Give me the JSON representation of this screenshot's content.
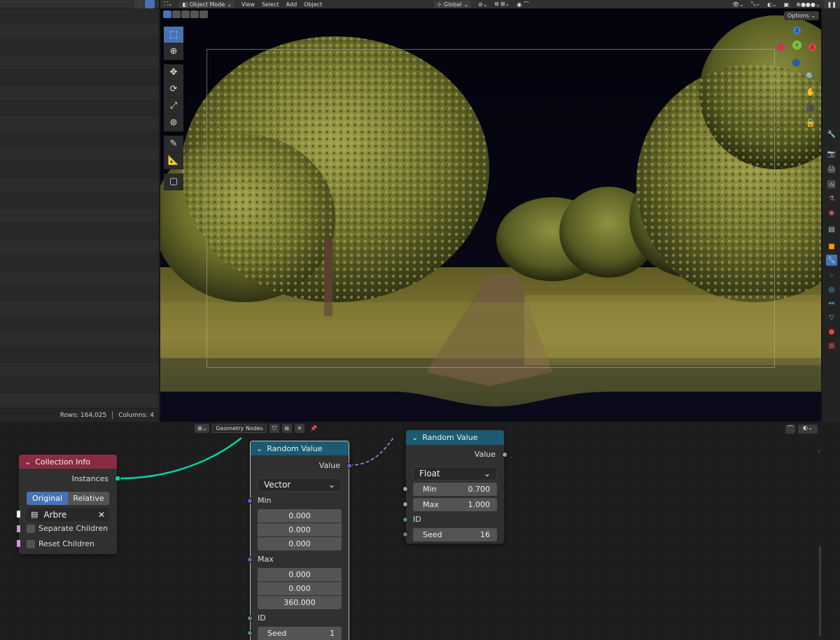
{
  "spreadsheet": {
    "rows_label": "Rows: 164,025",
    "columns_label": "Columns: 4"
  },
  "viewport_header": {
    "mode": "Object Mode",
    "menus": [
      "View",
      "Select",
      "Add",
      "Object"
    ],
    "transform_orientation": "Global",
    "options_label": "Options"
  },
  "gizmo": {
    "z": "Z",
    "y": "Y",
    "x": "X"
  },
  "node_editor_header": {
    "tree_name": "Geometry Nodes"
  },
  "nodes": {
    "collection_info": {
      "title": "Collection Info",
      "output": "Instances",
      "mode_original": "Original",
      "mode_relative": "Relative",
      "collection": "Arbre",
      "separate_children": "Separate Children",
      "reset_children": "Reset Children",
      "header_color": "#8a2b43"
    },
    "random_value_1": {
      "title": "Random Value",
      "output": "Value",
      "type": "Vector",
      "min_label": "Min",
      "min": [
        "0.000",
        "0.000",
        "0.000"
      ],
      "max_label": "Max",
      "max": [
        "0.000",
        "0.000",
        "360.000"
      ],
      "id_label": "ID",
      "seed_label": "Seed",
      "seed": "1",
      "header_color": "#1b5a73"
    },
    "random_value_2": {
      "title": "Random Value",
      "output": "Value",
      "type": "Float",
      "min_label": "Min",
      "min": "0.700",
      "max_label": "Max",
      "max": "1.000",
      "id_label": "ID",
      "seed_label": "Seed",
      "seed": "16",
      "header_color": "#1b5a73"
    }
  },
  "colors": {
    "accent": "#4772b3",
    "geometry_link": "#00d6a3",
    "vector_socket": "#6363c7",
    "float_socket": "#a1a1a1",
    "int_socket": "#598c5c"
  }
}
